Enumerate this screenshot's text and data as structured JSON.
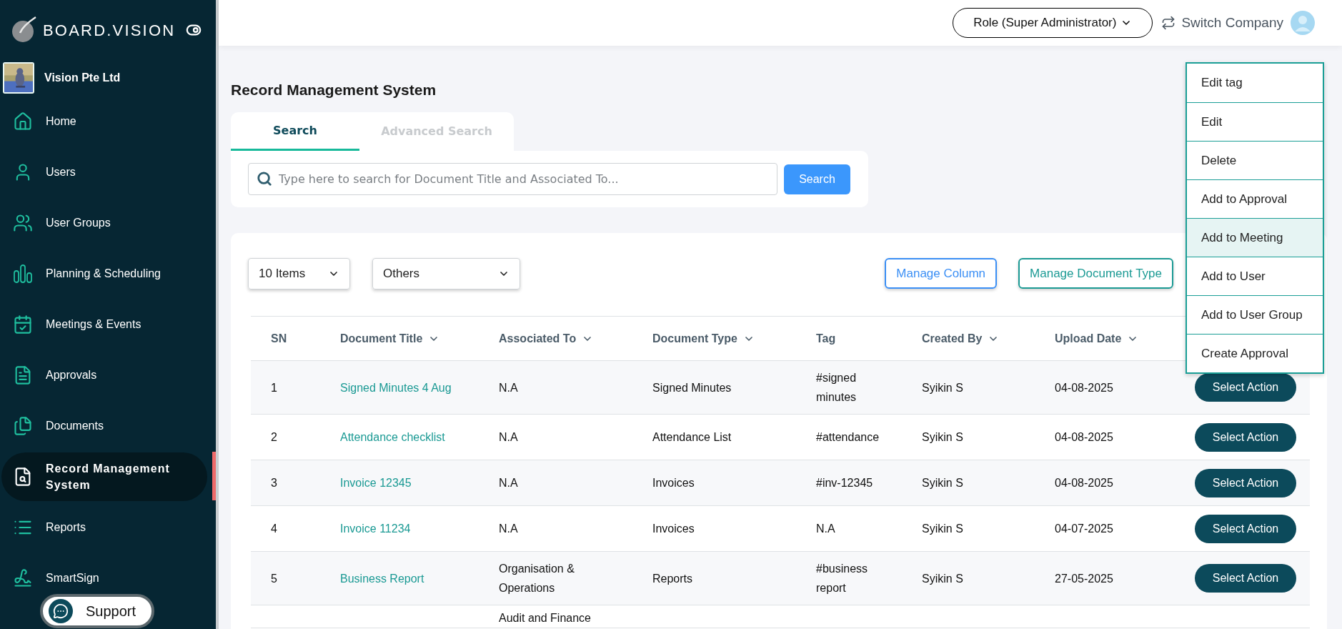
{
  "sidebar": {
    "brand": "BOARD.VISION",
    "company": "Vision Pte Ltd",
    "items": [
      {
        "label": "Home",
        "selected": false
      },
      {
        "label": "Users",
        "selected": false
      },
      {
        "label": "User Groups",
        "selected": false
      },
      {
        "label": "Planning & Scheduling",
        "selected": false
      },
      {
        "label": "Meetings & Events",
        "selected": false
      },
      {
        "label": "Approvals",
        "selected": false
      },
      {
        "label": "Documents",
        "selected": false
      },
      {
        "label": "Record Management System",
        "selected": true
      },
      {
        "label": "Reports",
        "selected": false
      },
      {
        "label": "SmartSign",
        "selected": false
      }
    ],
    "support_button": "Support"
  },
  "header": {
    "role_select": "Role (Super Administrator)",
    "switch_company": "Switch Company"
  },
  "page_title": "Record Management System",
  "tabs": [
    {
      "label": "Search",
      "selected": true
    },
    {
      "label": "Advanced Search",
      "selected": false
    }
  ],
  "search": {
    "placeholder": "Type here to search for Document Title and Associated To...",
    "button": "Search"
  },
  "toolbar": {
    "page_size": "10 Items",
    "category": "Others",
    "buttons": [
      {
        "label": "Manage Column",
        "kind": "primary"
      },
      {
        "label": "Manage Document Type",
        "kind": "secondary"
      }
    ]
  },
  "table": {
    "columns": [
      {
        "label": "SN",
        "sortable": false
      },
      {
        "label": "Document Title",
        "sortable": true
      },
      {
        "label": "Associated To",
        "sortable": true
      },
      {
        "label": "Document Type",
        "sortable": true
      },
      {
        "label": "Tag",
        "sortable": false
      },
      {
        "label": "Created By",
        "sortable": true
      },
      {
        "label": "Upload Date",
        "sortable": true
      }
    ],
    "rows": [
      {
        "sn": "1",
        "title": "Signed Minutes 4 Aug",
        "associated_to": "N.A",
        "document_type": "Signed Minutes",
        "tag": "#signed minutes",
        "created_by": "Syikin S",
        "upload_date": "04-08-2025",
        "action": "Select Action"
      },
      {
        "sn": "2",
        "title": "Attendance checklist",
        "associated_to": "N.A",
        "document_type": "Attendance List",
        "tag": "#attendance",
        "created_by": "Syikin S",
        "upload_date": "04-08-2025",
        "action": "Select Action"
      },
      {
        "sn": "3",
        "title": "Invoice 12345",
        "associated_to": "N.A",
        "document_type": "Invoices",
        "tag": "#inv-12345",
        "created_by": "Syikin S",
        "upload_date": "04-08-2025",
        "action": "Select Action"
      },
      {
        "sn": "4",
        "title": "Invoice 11234",
        "associated_to": "N.A",
        "document_type": "Invoices",
        "tag": "N.A",
        "created_by": "Syikin S",
        "upload_date": "04-07-2025",
        "action": "Select Action"
      },
      {
        "sn": "5",
        "title": "Business Report",
        "associated_to": "Organisation & Operations",
        "document_type": "Reports",
        "tag": "#business report",
        "created_by": "Syikin S",
        "upload_date": "27-05-2025",
        "action": "Select Action"
      },
      {
        "associated_to": "Audit and Finance"
      }
    ]
  },
  "action_menu": {
    "items": [
      {
        "label": "Edit tag",
        "selected": false
      },
      {
        "label": "Edit",
        "selected": false
      },
      {
        "label": "Delete",
        "selected": false
      },
      {
        "label": "Add to Approval",
        "selected": false
      },
      {
        "label": "Add to Meeting",
        "selected": true
      },
      {
        "label": "Add to User",
        "selected": false
      },
      {
        "label": "Add to User Group",
        "selected": false
      },
      {
        "label": "Create Approval",
        "selected": false
      }
    ]
  }
}
